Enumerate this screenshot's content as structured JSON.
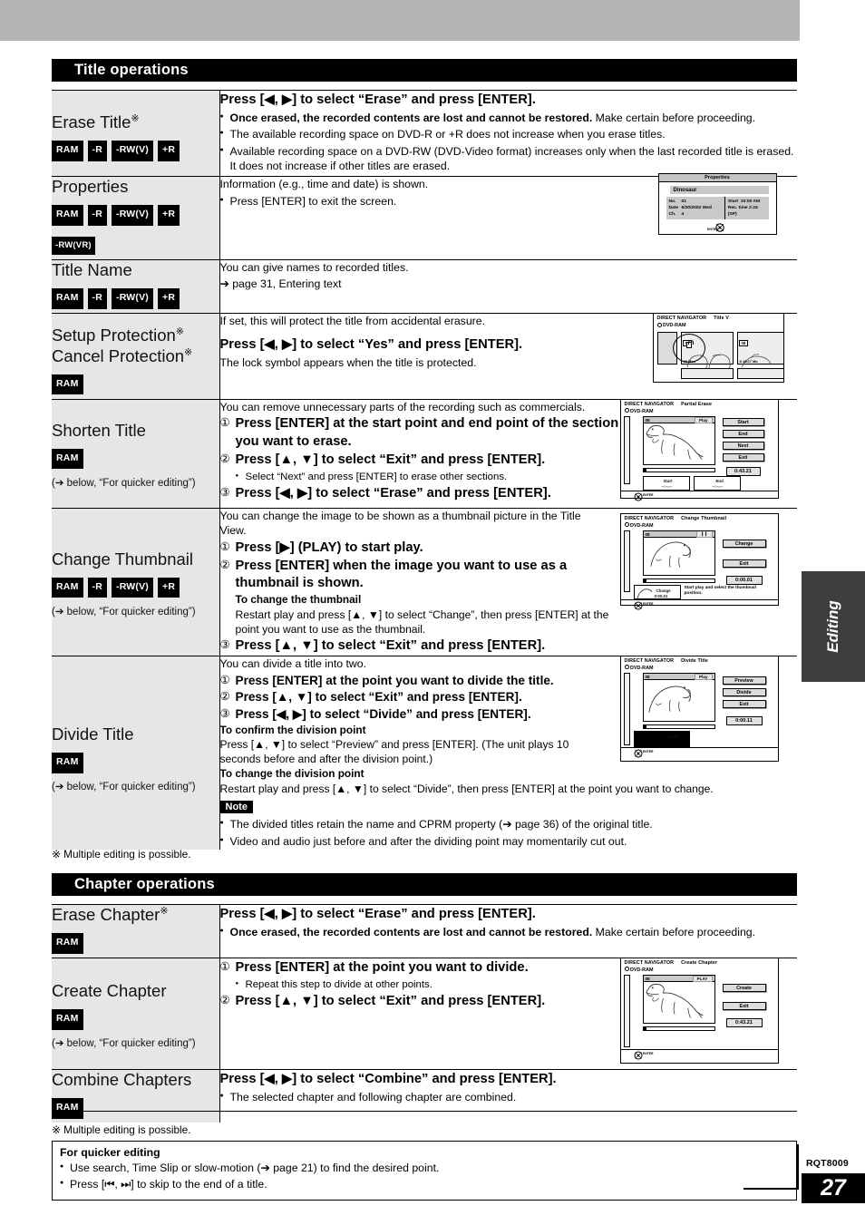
{
  "page": {
    "number": "27",
    "doc_code": "RQT8009",
    "side_tab": "Editing"
  },
  "sections": [
    {
      "id": "title_ops",
      "heading": "Title operations"
    },
    {
      "id": "chapter_ops",
      "heading": "Chapter operations"
    }
  ],
  "title_operations": [
    {
      "name": "Erase Title",
      "asterisk": "※",
      "badges": [
        "RAM",
        "-R",
        "-RW(V)",
        "+R"
      ],
      "heading": "Press [◀, ▶] to select “Erase” and press [ENTER].",
      "bullets": [
        {
          "bold_part": "Once erased, the recorded contents are lost and cannot be restored.",
          "rest": " Make certain before proceeding."
        },
        {
          "bold_part": "",
          "rest": "The available recording space on DVD-R or +R does not increase when you erase titles."
        },
        {
          "bold_part": "",
          "rest": "Available recording space on a DVD-RW (DVD-Video format) increases only when the last recorded title is erased. It does not increase if other titles are erased."
        }
      ]
    },
    {
      "name": "Properties",
      "badges": [
        "RAM",
        "-R",
        "-RW(V)",
        "+R",
        "-RW(VR)"
      ],
      "lead": "Information (e.g., time and date) is shown.",
      "bullets": [
        {
          "bold_part": "",
          "rest": "Press [ENTER] to exit the screen."
        }
      ],
      "screen": {
        "title": "Properties",
        "name": "Dinosaur",
        "fields": [
          {
            "key": "No.",
            "value": "01"
          },
          {
            "key": "Date",
            "value": "6/20/2002 Wed"
          },
          {
            "key": "Ch.",
            "value": "4"
          },
          {
            "key": "Start",
            "value": "10:00 AM"
          },
          {
            "key": "Rec. time",
            "value": "2:15 (SP)"
          }
        ],
        "enter_label": "ENTER"
      }
    },
    {
      "name": "Title Name",
      "badges": [
        "RAM",
        "-R",
        "-RW(V)",
        "+R"
      ],
      "lead": "You can give names to recorded titles.",
      "ref": "➔ page 31, Entering text"
    },
    {
      "name": "Setup Protection",
      "name2": "Cancel Protection",
      "asterisk": "※",
      "badges": [
        "RAM"
      ],
      "lead": "If set, this will protect the title from accidental erasure.",
      "heading": "Press [◀, ▶] to select “Yes” and press [ENTER].",
      "after": "The lock symbol appears when the title is protected.",
      "screen": {
        "title": "DIRECT NAVIGATOR",
        "subtitle": "Title V",
        "disc": "DVD-RAM",
        "thumbs": [
          {
            "no": "07",
            "caption": "25  Mon"
          },
          {
            "no": "08",
            "caption": "8 10/27 Mo"
          }
        ]
      }
    },
    {
      "name": "Shorten Title",
      "badges": [
        "RAM"
      ],
      "subnote": "(➔ below, “For quicker editing”)",
      "lead": "You can remove unnecessary parts of the recording such as commercials.",
      "steps": [
        {
          "num": "①",
          "text": "Press [ENTER] at the start point and end point of the section you want to erase."
        },
        {
          "num": "②",
          "text": "Press [▲, ▼] to select “Exit” and press [ENTER]."
        },
        {
          "num": "③",
          "text": "Press [◀, ▶] to select “Erase” and press [ENTER]."
        }
      ],
      "substep_bullet": "Select “Next” and press [ENTER] to erase other sections.",
      "screen": {
        "title": "DIRECT NAVIGATOR",
        "subtitle": "Partial Erase",
        "disc": "DVD-RAM",
        "vid_no": "08",
        "vid_state": "Play",
        "buttons": [
          "Start",
          "End",
          "Next",
          "Exit"
        ],
        "time": "0:43.21",
        "markers": [
          "Start",
          "End"
        ],
        "marker_time": "--:--.--",
        "enter_label": "ENTER"
      }
    },
    {
      "name": "Change Thumbnail",
      "badges": [
        "RAM",
        "-R",
        "-RW(V)",
        "+R"
      ],
      "subnote": "(➔ below, “For quicker editing”)",
      "lead": "You can change the image to be shown as a thumbnail picture in the Title View.",
      "steps": [
        {
          "num": "①",
          "text": "Press [▶] (PLAY) to start play."
        },
        {
          "num": "②",
          "text": "Press [ENTER] when the image you want to use as a thumbnail is shown."
        },
        {
          "num": "③",
          "text": "Press [▲, ▼] to select “Exit” and press [ENTER]."
        }
      ],
      "sub_head": "To change the thumbnail",
      "sub_text": "Restart play and press [▲, ▼] to select “Change”, then press [ENTER] at the point you want to use as the thumbnail.",
      "screen": {
        "title": "DIRECT NAVIGATOR",
        "subtitle": "Change Thumbnail",
        "disc": "DVD-RAM",
        "vid_no": "08",
        "vid_state": "❙❙",
        "buttons": [
          "Change",
          "Exit"
        ],
        "time": "0:00.01",
        "marker": "Change",
        "marker_time": "0:00.01",
        "hint": "Start play and select the thumbnail position.",
        "enter_label": "ENTER"
      }
    },
    {
      "name": "Divide Title",
      "badges": [
        "RAM"
      ],
      "subnote": "(➔ below, “For quicker editing”)",
      "lead": "You can divide a title into two.",
      "steps": [
        {
          "num": "①",
          "text": "Press [ENTER] at the point you want to divide the title."
        },
        {
          "num": "②",
          "text": "Press [▲, ▼] to select “Exit” and press [ENTER]."
        },
        {
          "num": "③",
          "text": "Press [◀, ▶] to select “Divide” and press [ENTER]."
        }
      ],
      "sub_head1": "To confirm the division point",
      "sub_text1": "Press [▲, ▼] to select “Preview” and press [ENTER]. (The unit plays 10 seconds before and after the division point.)",
      "sub_head2": "To change the division point",
      "sub_text2": "Restart play and press [▲, ▼] to select “Divide”, then press [ENTER] at the point you want to change.",
      "note_tag": "Note",
      "note_bullets": [
        "The divided titles retain the name and CPRM property (➔ page 36) of the original title.",
        "Video and audio just before and after the dividing point may momentarily cut out."
      ],
      "screen": {
        "title": "DIRECT NAVIGATOR",
        "subtitle": "Divide Title",
        "disc": "DVD-RAM",
        "vid_no": "08",
        "vid_state": "Play",
        "buttons": [
          "Preview",
          "Divide",
          "Exit"
        ],
        "time": "0:00.11",
        "marker": "Divide",
        "marker_time": "--:--.--",
        "enter_label": "ENTER"
      }
    }
  ],
  "title_footnote": "※ Multiple editing is possible.",
  "chapter_operations": [
    {
      "name": "Erase Chapter",
      "asterisk": "※",
      "badges": [
        "RAM"
      ],
      "heading": "Press [◀, ▶] to select “Erase” and press [ENTER].",
      "bullets": [
        {
          "bold_part": "Once erased, the recorded contents are lost and cannot be restored.",
          "rest": " Make certain before proceeding."
        }
      ]
    },
    {
      "name": "Create Chapter",
      "badges": [
        "RAM"
      ],
      "subnote": "(➔ below, “For quicker editing”)",
      "steps": [
        {
          "num": "①",
          "text": "Press [ENTER] at the point you want to divide."
        },
        {
          "num": "②",
          "text": "Press [▲, ▼] to select “Exit” and press [ENTER]."
        }
      ],
      "substep_bullet": "Repeat this step to divide at other points.",
      "screen": {
        "title": "DIRECT NAVIGATOR",
        "subtitle": "Create Chapter",
        "disc": "DVD-RAM",
        "vid_no": "08",
        "vid_state": "PLAY",
        "buttons": [
          "Create",
          "Exit"
        ],
        "time": "0:43.21",
        "enter_label": "ENTER"
      }
    },
    {
      "name": "Combine Chapters",
      "badges": [
        "RAM"
      ],
      "heading": "Press [◀, ▶] to select “Combine” and press [ENTER].",
      "bullets": [
        {
          "bold_part": "",
          "rest": "The selected chapter and following chapter are combined."
        }
      ]
    }
  ],
  "chapter_footnote": "※ Multiple editing is possible.",
  "quicker_box": {
    "title": "For quicker editing",
    "bullets": [
      "Use search, Time Slip or slow-motion (➔ page 21) to find the desired point.",
      "Press [⏮, ⏭] to skip to the end of a title."
    ]
  }
}
